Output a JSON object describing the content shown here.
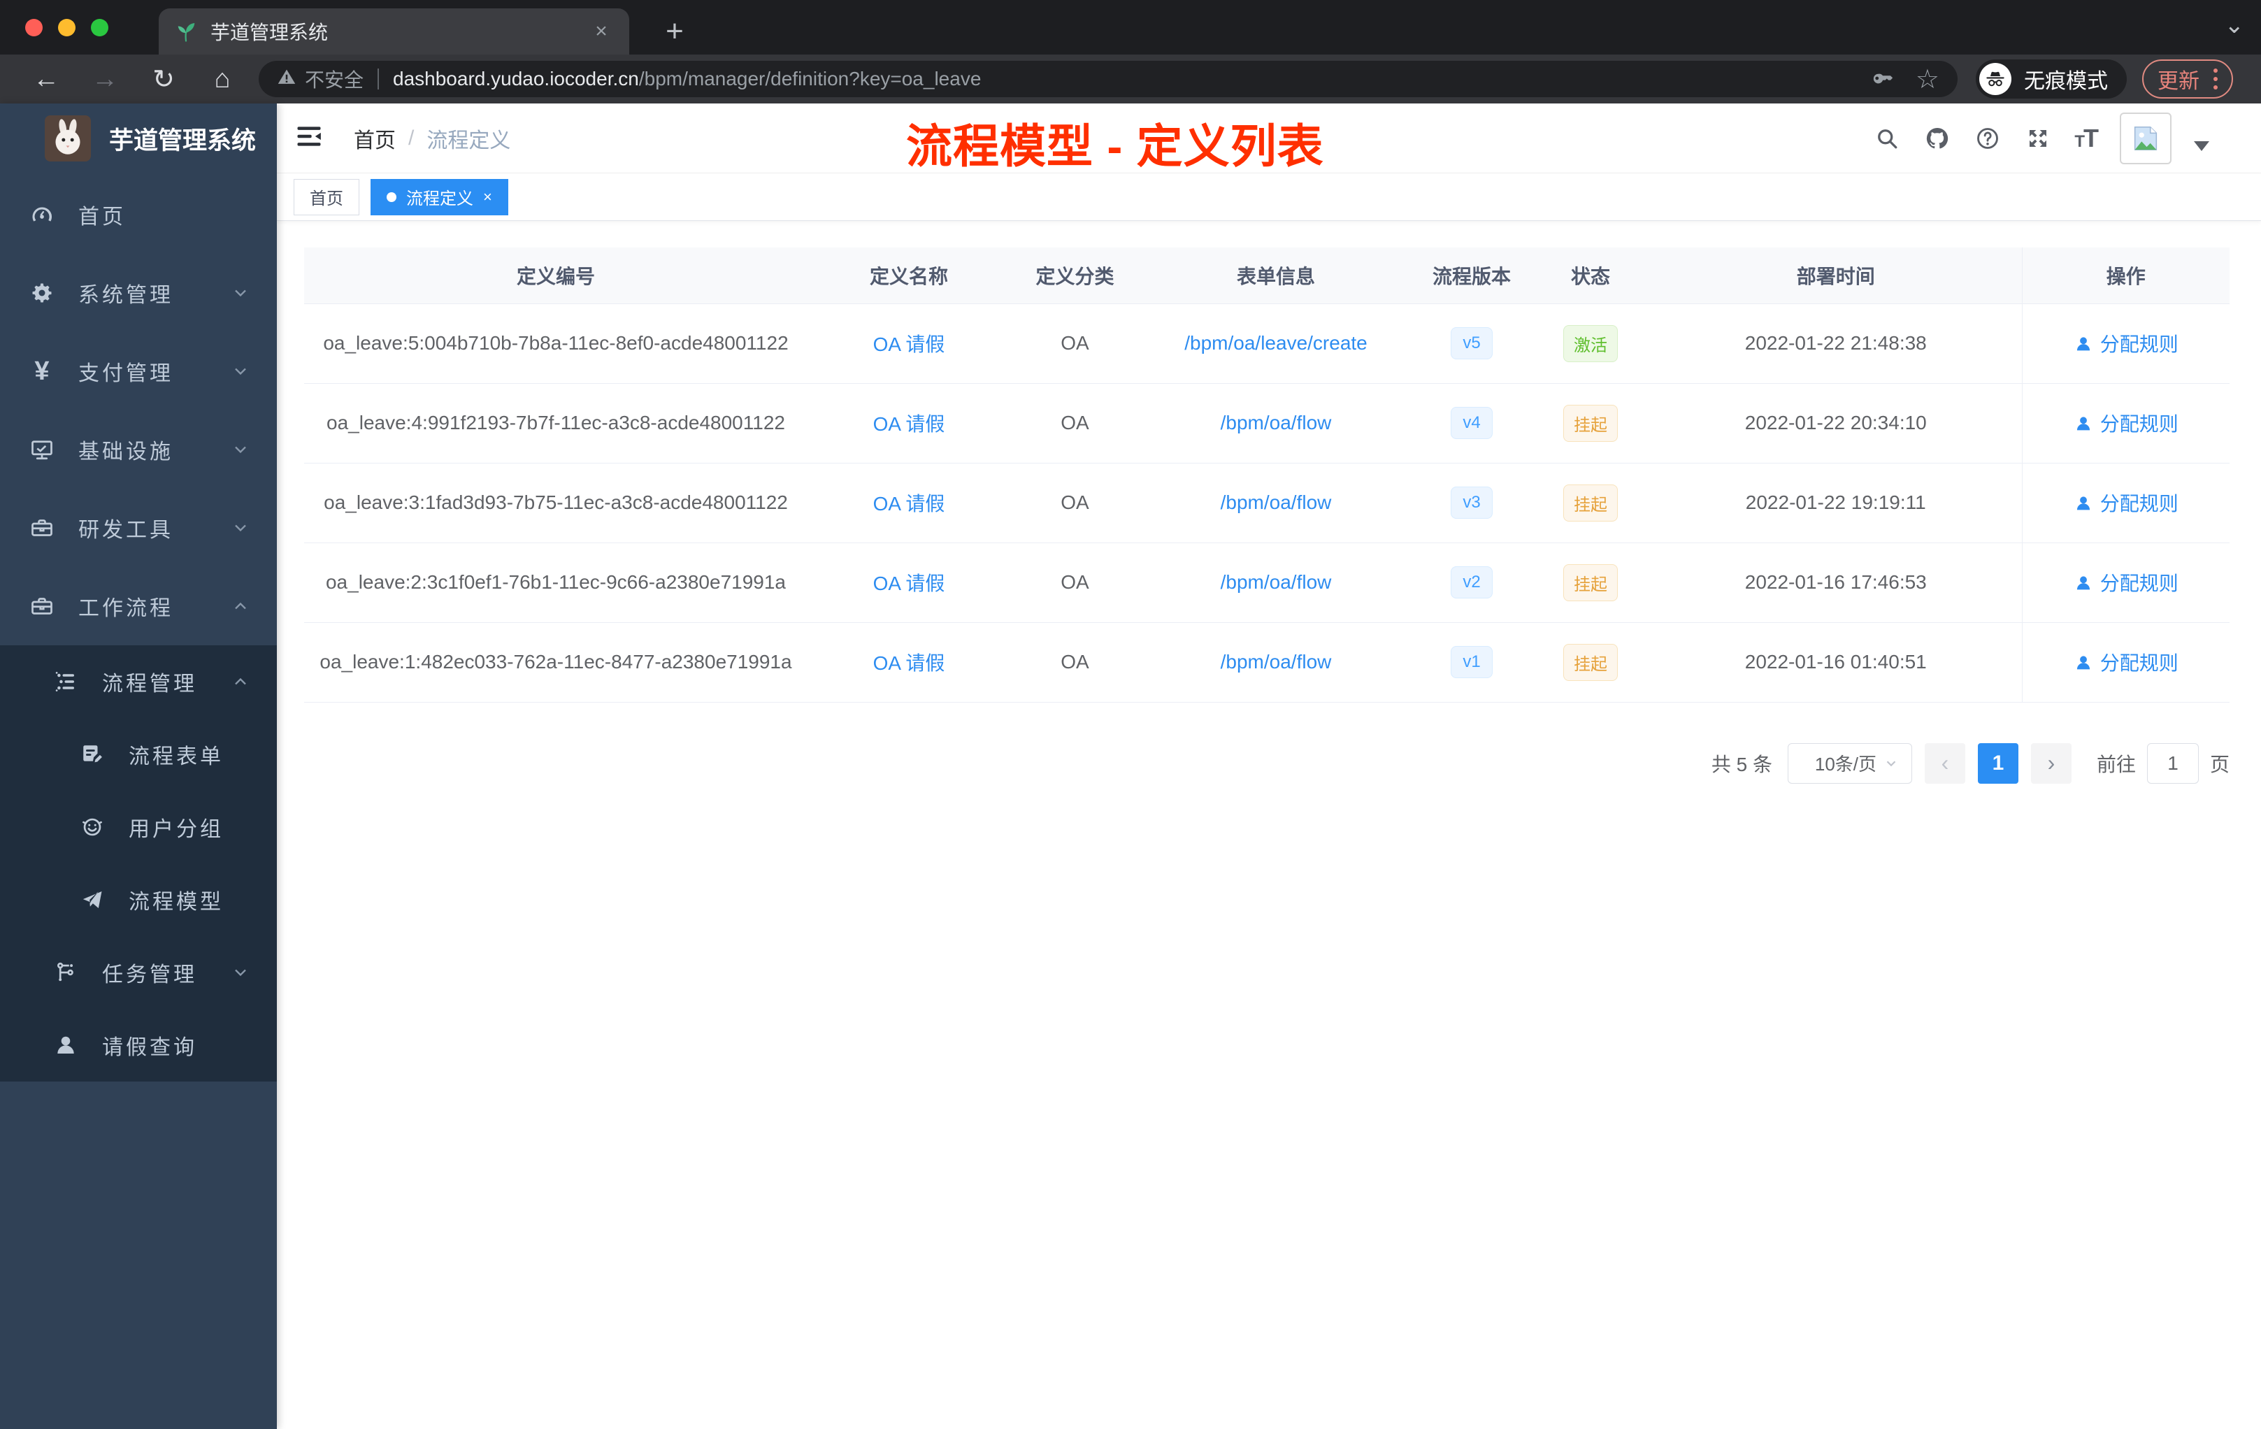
{
  "colors": {
    "accent": "#2b8ef3",
    "link": "#2d8cf0",
    "success": "#5ebe2c",
    "warning": "#e6a23c",
    "annotation": "#ff2f00",
    "sidebar_bg": "#304156",
    "submenu_bg": "#1f2d3d"
  },
  "browser": {
    "tab_title": "芋道管理系统",
    "favicon": "sprout-icon",
    "insecure_label": "不安全",
    "url_host": "dashboard.yudao.iocoder.cn",
    "url_path": "/bpm/manager/definition?key=oa_leave",
    "incognito_label": "无痕模式",
    "update_label": "更新"
  },
  "sidebar": {
    "app_title": "芋道管理系统",
    "items": [
      {
        "label": "首页",
        "icon": "dashboard-icon",
        "level": 1
      },
      {
        "label": "系统管理",
        "icon": "gear-icon",
        "level": 1,
        "chevron": "down"
      },
      {
        "label": "支付管理",
        "icon": "yen-icon",
        "level": 1,
        "chevron": "down"
      },
      {
        "label": "基础设施",
        "icon": "monitor-icon",
        "level": 1,
        "chevron": "down"
      },
      {
        "label": "研发工具",
        "icon": "toolbox-icon",
        "level": 1,
        "chevron": "down"
      },
      {
        "label": "工作流程",
        "icon": "toolbox-icon",
        "level": 1,
        "chevron": "up"
      },
      {
        "label": "流程管理",
        "icon": "list-icon",
        "level": 2,
        "chevron": "up",
        "dark": true
      },
      {
        "label": "流程表单",
        "icon": "form-icon",
        "level": 3,
        "dark": true
      },
      {
        "label": "用户分组",
        "icon": "user-group-icon",
        "level": 3,
        "dark": true
      },
      {
        "label": "流程模型",
        "icon": "paper-plane-icon",
        "level": 3,
        "dark": true
      },
      {
        "label": "任务管理",
        "icon": "flow-icon",
        "level": 2,
        "chevron": "down",
        "dark": true
      },
      {
        "label": "请假查询",
        "icon": "person-icon",
        "level": 2,
        "dark": true
      }
    ]
  },
  "header": {
    "breadcrumb_home": "首页",
    "breadcrumb_sep": "/",
    "breadcrumb_current": "流程定义",
    "right_icons": [
      "search-icon",
      "github-icon",
      "help-icon",
      "fullscreen-icon",
      "text-size-icon",
      "avatar",
      "caret-down-icon"
    ]
  },
  "annotation": {
    "text": "流程模型 - 定义列表"
  },
  "tagbar": {
    "tags": [
      {
        "label": "首页",
        "active": false,
        "closable": false
      },
      {
        "label": "流程定义",
        "active": true,
        "closable": true
      }
    ],
    "close_glyph": "×"
  },
  "table": {
    "columns": [
      "定义编号",
      "定义名称",
      "定义分类",
      "表单信息",
      "流程版本",
      "状态",
      "部署时间",
      "操作"
    ],
    "rows": [
      {
        "id": "oa_leave:5:004b710b-7b8a-11ec-8ef0-acde48001122",
        "name": "OA 请假",
        "category": "OA",
        "form": "/bpm/oa/leave/create",
        "version": "v5",
        "status": "激活",
        "status_type": "success",
        "time": "2022-01-22 21:48:38",
        "action": "分配规则"
      },
      {
        "id": "oa_leave:4:991f2193-7b7f-11ec-a3c8-acde48001122",
        "name": "OA 请假",
        "category": "OA",
        "form": "/bpm/oa/flow",
        "version": "v4",
        "status": "挂起",
        "status_type": "warning",
        "time": "2022-01-22 20:34:10",
        "action": "分配规则"
      },
      {
        "id": "oa_leave:3:1fad3d93-7b75-11ec-a3c8-acde48001122",
        "name": "OA 请假",
        "category": "OA",
        "form": "/bpm/oa/flow",
        "version": "v3",
        "status": "挂起",
        "status_type": "warning",
        "time": "2022-01-22 19:19:11",
        "action": "分配规则"
      },
      {
        "id": "oa_leave:2:3c1f0ef1-76b1-11ec-9c66-a2380e71991a",
        "name": "OA 请假",
        "category": "OA",
        "form": "/bpm/oa/flow",
        "version": "v2",
        "status": "挂起",
        "status_type": "warning",
        "time": "2022-01-16 17:46:53",
        "action": "分配规则"
      },
      {
        "id": "oa_leave:1:482ec033-762a-11ec-8477-a2380e71991a",
        "name": "OA 请假",
        "category": "OA",
        "form": "/bpm/oa/flow",
        "version": "v1",
        "status": "挂起",
        "status_type": "warning",
        "time": "2022-01-16 01:40:51",
        "action": "分配规则"
      }
    ]
  },
  "pagination": {
    "total": "共 5 条",
    "page_size": "10条/页",
    "prev_glyph": "‹",
    "next_glyph": "›",
    "current_page": "1",
    "goto_label": "前往",
    "goto_value": "1",
    "page_suffix": "页"
  }
}
